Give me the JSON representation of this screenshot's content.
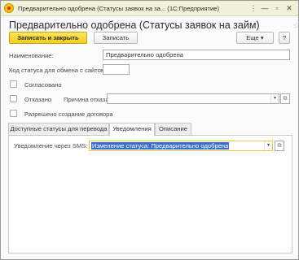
{
  "window": {
    "title": "Предварительно одобрена (Статусы заявок на за...  (1С:Предприятие)",
    "controls": [
      "⋮",
      "—",
      "▫",
      "✕"
    ]
  },
  "form": {
    "heading": "Предварительно одобрена (Статусы заявок на займ)",
    "star": "☆"
  },
  "toolbar": {
    "save_close_label": "Записать и закрыть",
    "save_label": "Записать",
    "more_label": "Еще",
    "more_arrow": "▾",
    "help_label": "?"
  },
  "fields": {
    "name_label": "Наименование:",
    "name_value": "Предварительно одобрена",
    "exchange_code_label": "Код статуса для обмена с сайтом:",
    "exchange_code_value": "",
    "approved_label": "Согласовано",
    "approved_checked": false,
    "rejected_label": "Отказано",
    "rejected_checked": false,
    "reject_reason_label": "Причина отказа:",
    "reject_reason_value": "",
    "contract_allowed_label": "Разрешено создание договора",
    "contract_allowed_checked": false
  },
  "tabs": [
    {
      "label": "Доступные статусы для перевода",
      "active": false
    },
    {
      "label": "Уведомления",
      "active": true
    },
    {
      "label": "Описание",
      "active": false
    }
  ],
  "notifications": {
    "sms_label": "Уведомление через SMS:",
    "sms_value": "Изменение статуса: Предварительно одобрена"
  },
  "icons": {
    "dropdown": "▾",
    "open": "⧉"
  },
  "colors": {
    "titlebar_bg": "#f1f0d8",
    "primary_button": "#f2ce1d",
    "selection": "#3a6ec9",
    "focus_border": "#e8c93c"
  }
}
